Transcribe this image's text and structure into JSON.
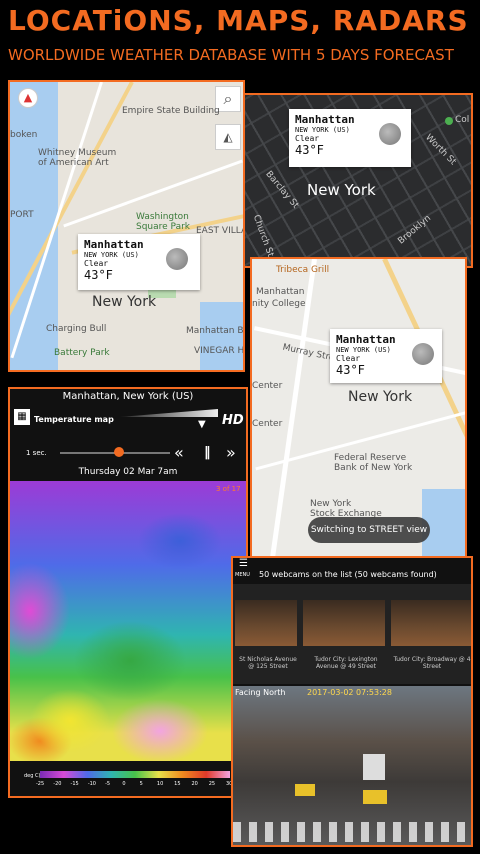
{
  "header": {
    "title": "LOCATiONS, MAPS, RADARS",
    "subtitle": "WORLDWIDE WEATHER DATABASE WITH 5 DAYS FORECAST"
  },
  "map1": {
    "labels": {
      "empire": "Empire State Building",
      "boken": "boken",
      "museum": "Whitney Museum\nof American Art",
      "washington": "Washington\nSquare Park",
      "east_village": "EAST VILLAG",
      "port": "PORT",
      "charging": "Charging Bull",
      "battery": "Battery Park",
      "manhattan_br": "Manhattan Br",
      "vinegar": "VINEGAR HILL",
      "newyork": "New York"
    },
    "popup": {
      "city": "Manhattan",
      "region": "NEW YORK (US)",
      "condition": "Clear",
      "temp": "43°F"
    }
  },
  "map2": {
    "popup": {
      "city": "Manhattan",
      "region": "NEW YORK (US)",
      "condition": "Clear",
      "temp": "43°F"
    },
    "city_label": "New York",
    "street_labels": {
      "a": "Col",
      "b": "Worth St",
      "c": "Barclay St",
      "d": "Church St",
      "e": "Brooklyn"
    }
  },
  "map3": {
    "labels": {
      "tribeca": "Tribeca Grill",
      "manhattan": "Manhattan",
      "college": "nity College",
      "murray": "Murray Street",
      "center1": "Center",
      "center2": "Center",
      "fed": "Federal Reserve\nBank of New York",
      "nyse": "New York\nStock Exchange",
      "newyork": "New York"
    },
    "popup": {
      "city": "Manhattan",
      "region": "NEW YORK (US)",
      "condition": "Clear",
      "temp": "43°F"
    },
    "toast": "Switching to STREET view"
  },
  "radar": {
    "location": "Manhattan, New York (US)",
    "layer": "Temperature map",
    "hd": "HD",
    "interval": "1 sec.",
    "date": "Thursday 02 Mar 7am",
    "frame": "3 of 17",
    "legend_unit": "deg C)",
    "legend_ticks": [
      "-25",
      "-20",
      "-15",
      "-10",
      "-5",
      "0",
      "5",
      "10",
      "15",
      "20",
      "25",
      "30"
    ]
  },
  "webcams": {
    "menu": "MENU",
    "count": "50 webcams on the list  (50 webcams found)",
    "cams": [
      {
        "label": "St Nicholas Avenue\n@ 125 Street"
      },
      {
        "label": "Tudor City: Lexington\nAvenue @ 49 Street"
      },
      {
        "label": "Tudor City: Broadway @ 4\nStreet"
      }
    ],
    "facing": "Facing North",
    "timestamp": "2017-03-02 07:53:28"
  }
}
